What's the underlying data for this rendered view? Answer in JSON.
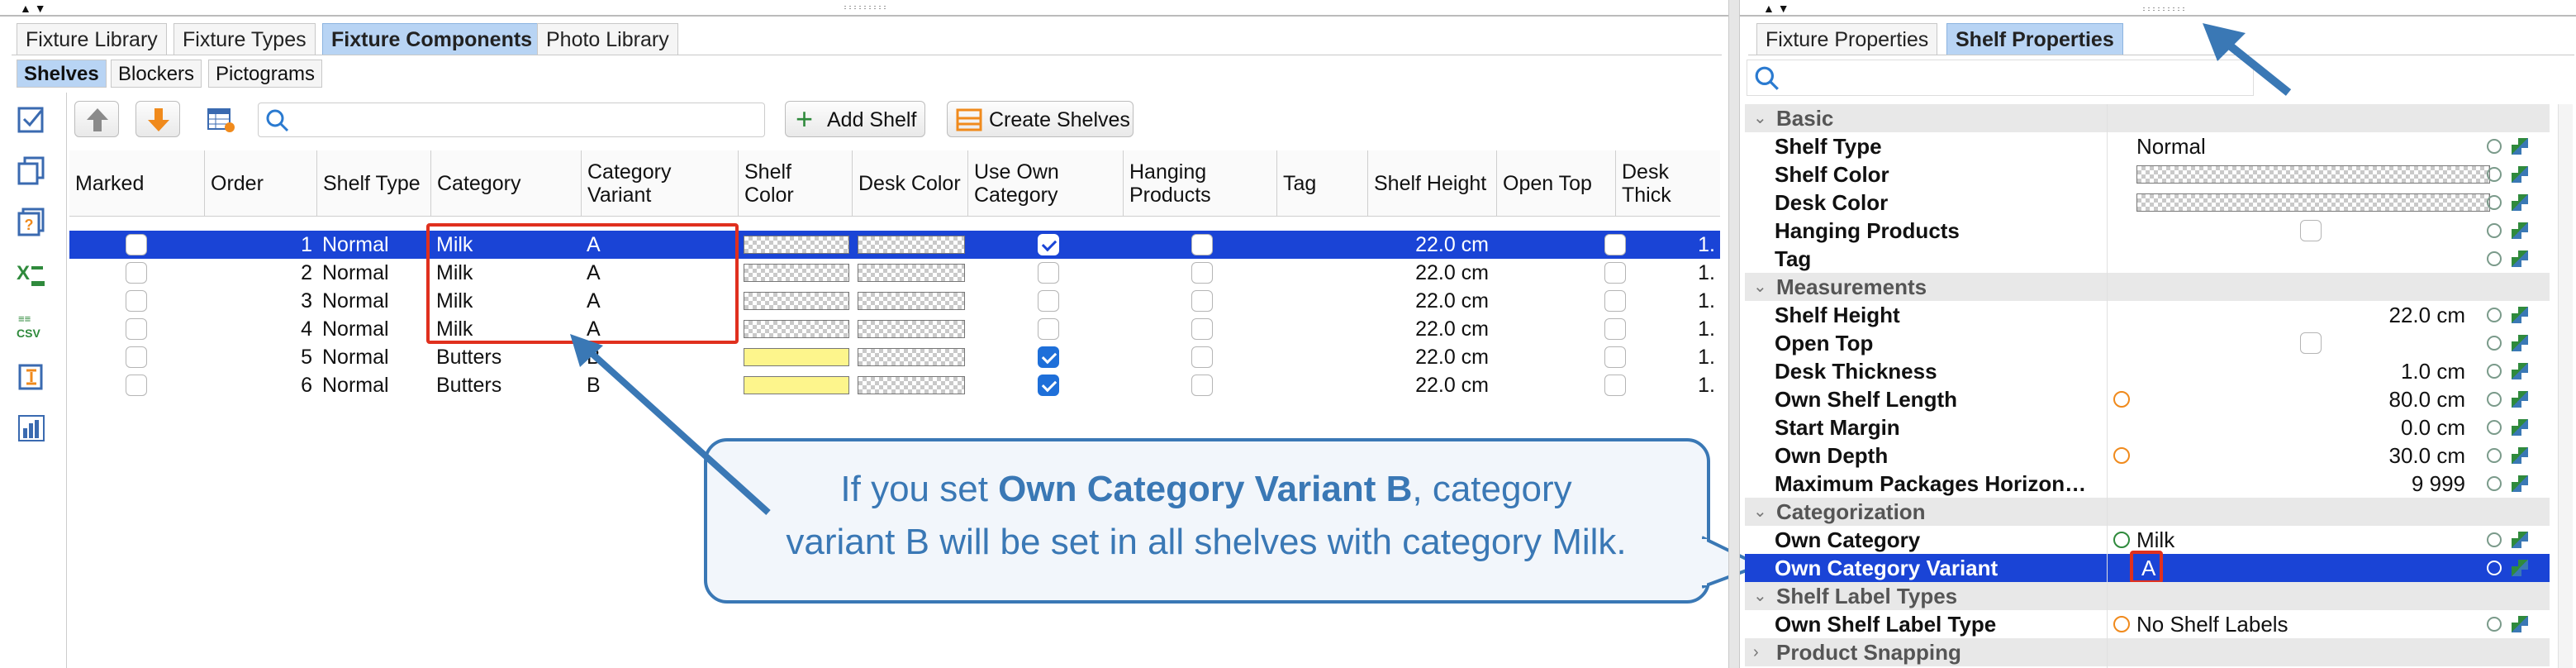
{
  "left_panel": {
    "main_tabs": [
      "Fixture Library",
      "Fixture Types",
      "Fixture Components",
      "Photo Library"
    ],
    "sub_tabs": [
      "Shelves",
      "Blockers",
      "Pictograms"
    ],
    "toolbar": {
      "search_placeholder": "",
      "add_shelf_label": "Add Shelf",
      "create_shelves_label": "Create Shelves"
    },
    "sidebar_icons": [
      "select-all-icon",
      "copy-icon",
      "help-icon",
      "excel-icon",
      "csv-icon",
      "sort-icon",
      "chart-icon"
    ],
    "table": {
      "columns": [
        "Marked",
        "Order",
        "Shelf Type",
        "Category",
        "Category Variant",
        "Shelf Color",
        "Desk Color",
        "Use Own Category",
        "Hanging Products",
        "Tag",
        "Shelf Height",
        "Open Top",
        "Desk Thick"
      ],
      "rows": [
        {
          "marked": false,
          "order": "1",
          "shelf_type": "Normal",
          "category": "Milk",
          "variant": "A",
          "shelf_color": "checker",
          "desk_color": "checker",
          "use_own_category": true,
          "hanging": false,
          "tag": "",
          "height": "22.0 cm",
          "open_top": false,
          "desk_thick": "1.",
          "selected": true
        },
        {
          "marked": false,
          "order": "2",
          "shelf_type": "Normal",
          "category": "Milk",
          "variant": "A",
          "shelf_color": "checker",
          "desk_color": "checker",
          "use_own_category": false,
          "hanging": false,
          "tag": "",
          "height": "22.0 cm",
          "open_top": false,
          "desk_thick": "1.",
          "selected": false
        },
        {
          "marked": false,
          "order": "3",
          "shelf_type": "Normal",
          "category": "Milk",
          "variant": "A",
          "shelf_color": "checker",
          "desk_color": "checker",
          "use_own_category": false,
          "hanging": false,
          "tag": "",
          "height": "22.0 cm",
          "open_top": false,
          "desk_thick": "1.",
          "selected": false
        },
        {
          "marked": false,
          "order": "4",
          "shelf_type": "Normal",
          "category": "Milk",
          "variant": "A",
          "shelf_color": "checker",
          "desk_color": "checker",
          "use_own_category": false,
          "hanging": false,
          "tag": "",
          "height": "22.0 cm",
          "open_top": false,
          "desk_thick": "1.",
          "selected": false
        },
        {
          "marked": false,
          "order": "5",
          "shelf_type": "Normal",
          "category": "Butters",
          "variant": "B",
          "shelf_color": "yellow",
          "desk_color": "checker",
          "use_own_category": true,
          "hanging": false,
          "tag": "",
          "height": "22.0 cm",
          "open_top": false,
          "desk_thick": "1.",
          "selected": false
        },
        {
          "marked": false,
          "order": "6",
          "shelf_type": "Normal",
          "category": "Butters",
          "variant": "B",
          "shelf_color": "yellow",
          "desk_color": "checker",
          "use_own_category": true,
          "hanging": false,
          "tag": "",
          "height": "22.0 cm",
          "open_top": false,
          "desk_thick": "1.",
          "selected": false
        }
      ]
    }
  },
  "callout": {
    "line1_pre": "If you set ",
    "line1_bold": "Own Category Variant B",
    "line1_post": ", category",
    "line2": "variant B will be set in all shelves with category Milk."
  },
  "right_panel": {
    "tabs": [
      "Fixture Properties",
      "Shelf Properties"
    ],
    "search_placeholder": "",
    "sections": [
      {
        "title": "Basic",
        "props": [
          {
            "label": "Shelf Type",
            "value": "Normal",
            "kind": "text-left"
          },
          {
            "label": "Shelf Color",
            "value": "",
            "kind": "checker"
          },
          {
            "label": "Desk Color",
            "value": "",
            "kind": "checker"
          },
          {
            "label": "Hanging Products",
            "value": "",
            "kind": "checkbox"
          },
          {
            "label": "Tag",
            "value": "",
            "kind": "text-left"
          }
        ]
      },
      {
        "title": "Measurements",
        "props": [
          {
            "label": "Shelf Height",
            "value": "22.0 cm",
            "kind": "text-right"
          },
          {
            "label": "Open Top",
            "value": "",
            "kind": "checkbox"
          },
          {
            "label": "Desk Thickness",
            "value": "1.0 cm",
            "kind": "text-right"
          },
          {
            "label": "Own Shelf Length",
            "value": "80.0 cm",
            "kind": "text-right-own"
          },
          {
            "label": "Start Margin",
            "value": "0.0 cm",
            "kind": "text-right"
          },
          {
            "label": "Own Depth",
            "value": "30.0 cm",
            "kind": "text-right-own"
          },
          {
            "label": "Maximum Packages Horizon…",
            "value": "9 999",
            "kind": "text-right"
          }
        ]
      },
      {
        "title": "Categorization",
        "props": [
          {
            "label": "Own Category",
            "value": "Milk",
            "kind": "text-left-own-green"
          },
          {
            "label": "Own Category Variant",
            "value": "A",
            "kind": "selected"
          }
        ]
      },
      {
        "title": "Shelf Label Types",
        "props": [
          {
            "label": "Own Shelf Label Type",
            "value": "No Shelf Labels",
            "kind": "text-left-own"
          }
        ]
      },
      {
        "title": "Product Snapping",
        "collapsed": true,
        "props": []
      }
    ]
  },
  "colors": {
    "selection": "#1a44d6",
    "highlight_tab": "#b8d4f4",
    "callout_border": "#3a78b5",
    "callout_text": "#3a78b5",
    "callout_bg": "#f2f6fb",
    "red_box": "#e0301e",
    "arrow": "#3a78b5"
  }
}
